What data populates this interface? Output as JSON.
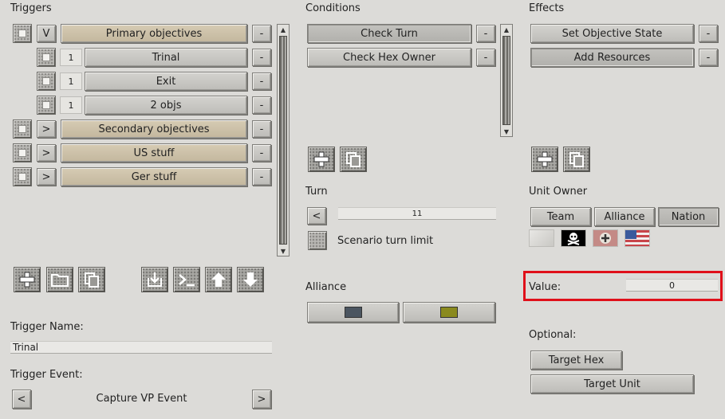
{
  "triggers": {
    "title": "Triggers",
    "rows": [
      {
        "expander": "V",
        "label": "Primary objectives",
        "minus": "-"
      },
      {
        "num": "1",
        "label": "Trinal",
        "minus": "-"
      },
      {
        "num": "1",
        "label": "Exit",
        "minus": "-"
      },
      {
        "num": "1",
        "label": "2 objs",
        "minus": "-"
      },
      {
        "expander": ">",
        "label": "Secondary objectives",
        "minus": "-"
      },
      {
        "expander": ">",
        "label": "US stuff",
        "minus": "-"
      },
      {
        "expander": ">",
        "label": "Ger stuff",
        "minus": "-"
      }
    ],
    "scroll_up": "▲",
    "scroll_down": "▼"
  },
  "conditions": {
    "title": "Conditions",
    "items": [
      {
        "label": "Check Turn",
        "minus": "-"
      },
      {
        "label": "Check Hex Owner",
        "minus": "-"
      }
    ],
    "scroll_up": "▲",
    "scroll_down": "▼"
  },
  "effects": {
    "title": "Effects",
    "items": [
      {
        "label": "Set Objective State",
        "minus": "-"
      },
      {
        "label": "Add Resources",
        "minus": "-"
      }
    ]
  },
  "turn": {
    "label": "Turn",
    "prev": "<",
    "value": "11",
    "scenario_limit_label": "Scenario turn limit"
  },
  "alliance": {
    "label": "Alliance",
    "color_1": "#4b5560",
    "color_2": "#8a8a1e"
  },
  "unit_owner": {
    "label": "Unit Owner",
    "tabs": [
      "Team",
      "Alliance",
      "Nation"
    ]
  },
  "value": {
    "label": "Value:",
    "input": "0"
  },
  "optional": {
    "label": "Optional:",
    "target_hex": "Target Hex",
    "target_unit": "Target Unit"
  },
  "trigger_name": {
    "label": "Trigger Name:",
    "value": "Trinal"
  },
  "trigger_event": {
    "label": "Trigger Event:",
    "prev": "<",
    "next": ">",
    "value": "Capture VP Event"
  },
  "icons": {
    "add": "plus-icon",
    "folder": "folder-icon",
    "copy": "copy-icon",
    "import": "import-icon",
    "console": "console-icon",
    "up": "arrow-up-icon",
    "down": "arrow-down-icon"
  },
  "colors": {
    "highlight": "#e0101a",
    "tan_button": "#cfc3aa"
  }
}
